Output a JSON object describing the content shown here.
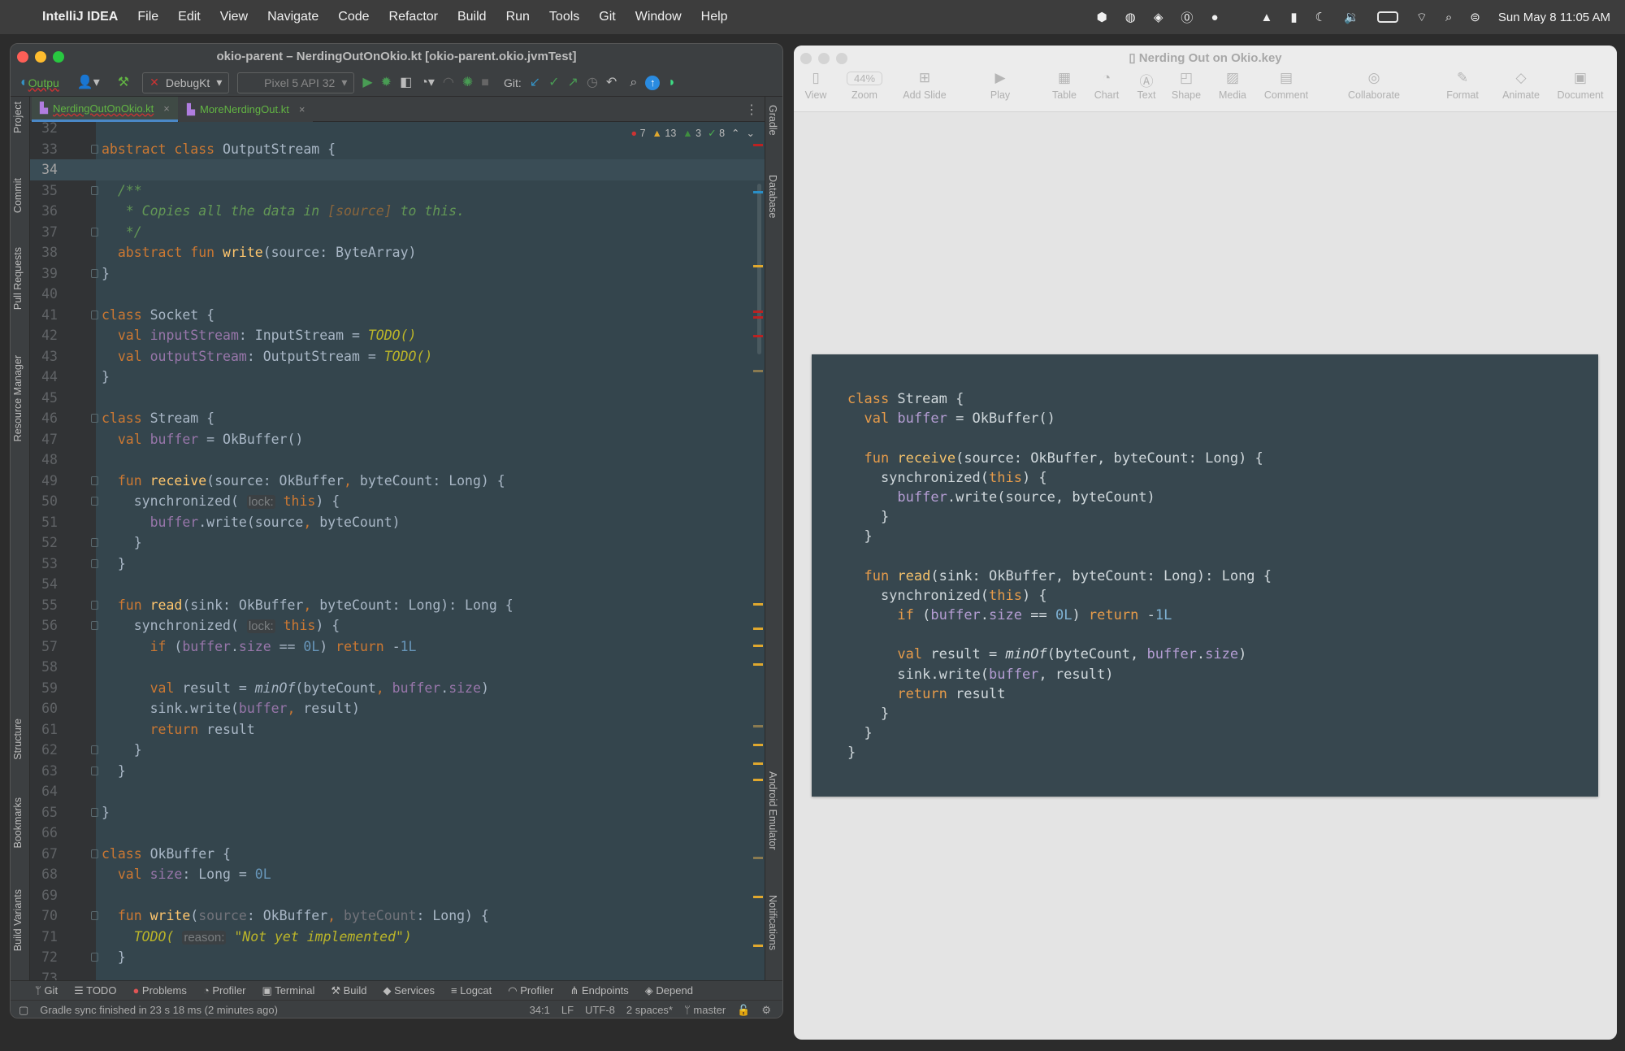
{
  "menubar": {
    "app": "IntelliJ IDEA",
    "items": [
      "File",
      "Edit",
      "View",
      "Navigate",
      "Code",
      "Refactor",
      "Build",
      "Run",
      "Tools",
      "Git",
      "Window",
      "Help"
    ],
    "clock": "Sun May 8  11:05 AM"
  },
  "ide": {
    "title": "okio-parent – NerdingOutOnOkio.kt [okio-parent.okio.jvmTest]",
    "toolbar": {
      "config": "Outpu",
      "run_config": "DebugKt",
      "device": "Pixel 5 API 32",
      "git_label": "Git:"
    },
    "tabs": [
      {
        "label": "NerdingOutOnOkio.kt",
        "active": true
      },
      {
        "label": "MoreNerdingOut.kt",
        "active": false
      }
    ],
    "left_tools": [
      "Project",
      "Commit",
      "Pull Requests",
      "Resource Manager",
      "Structure",
      "Bookmarks",
      "Build Variants"
    ],
    "right_tools": [
      "Gradle",
      "Database",
      "Android Emulator",
      "Notifications"
    ],
    "inspections": {
      "errors": "7",
      "warnings": "13",
      "weak_warnings": "3",
      "typos": "8"
    },
    "current_line": 34,
    "code": [
      [
        32,
        []
      ],
      [
        33,
        [
          [
            "k",
            "abstract class "
          ],
          [
            "p",
            "OutputStream {"
          ]
        ]
      ],
      [
        34,
        []
      ],
      [
        35,
        [
          [
            "c",
            "  /**"
          ]
        ]
      ],
      [
        36,
        [
          [
            "c",
            "   * Copies all the data in "
          ],
          [
            "cr",
            "[source]"
          ],
          [
            "c",
            " to this."
          ]
        ]
      ],
      [
        37,
        [
          [
            "c",
            "   */"
          ]
        ]
      ],
      [
        38,
        [
          [
            "k",
            "  abstract fun "
          ],
          [
            "f",
            "write"
          ],
          [
            "p",
            "(source: ByteArray)"
          ]
        ]
      ],
      [
        39,
        [
          [
            "p",
            "}"
          ]
        ]
      ],
      [
        40,
        []
      ],
      [
        41,
        [
          [
            "k",
            "class "
          ],
          [
            "p",
            "Socket {"
          ]
        ]
      ],
      [
        42,
        [
          [
            "k",
            "  val "
          ],
          [
            "v",
            "inputStream"
          ],
          [
            "p",
            ": InputStream = "
          ],
          [
            "t",
            "TODO()"
          ]
        ]
      ],
      [
        43,
        [
          [
            "k",
            "  val "
          ],
          [
            "v",
            "outputStream"
          ],
          [
            "p",
            ": OutputStream = "
          ],
          [
            "t",
            "TODO()"
          ]
        ]
      ],
      [
        44,
        [
          [
            "p",
            "}"
          ]
        ]
      ],
      [
        45,
        []
      ],
      [
        46,
        [
          [
            "k",
            "class "
          ],
          [
            "p",
            "Stream {"
          ]
        ]
      ],
      [
        47,
        [
          [
            "k",
            "  val "
          ],
          [
            "v",
            "buffer"
          ],
          [
            "p",
            " = OkBuffer()"
          ]
        ]
      ],
      [
        48,
        []
      ],
      [
        49,
        [
          [
            "k",
            "  fun "
          ],
          [
            "f",
            "receive"
          ],
          [
            "p",
            "(source: OkBuffer"
          ],
          [
            "k",
            ","
          ],
          [
            "p",
            " byteCount: Long) {"
          ]
        ]
      ],
      [
        50,
        [
          [
            "p",
            "    synchronized( "
          ],
          [
            "h",
            "lock:"
          ],
          [
            "k",
            " this"
          ],
          [
            "p",
            ") {"
          ]
        ]
      ],
      [
        51,
        [
          [
            "p",
            "      "
          ],
          [
            "v",
            "buffer"
          ],
          [
            "p",
            ".write(source"
          ],
          [
            "k",
            ","
          ],
          [
            "p",
            " byteCount)"
          ]
        ]
      ],
      [
        52,
        [
          [
            "p",
            "    }"
          ]
        ]
      ],
      [
        53,
        [
          [
            "p",
            "  }"
          ]
        ]
      ],
      [
        54,
        []
      ],
      [
        55,
        [
          [
            "k",
            "  fun "
          ],
          [
            "f",
            "read"
          ],
          [
            "p",
            "(sink: OkBuffer"
          ],
          [
            "k",
            ","
          ],
          [
            "p",
            " byteCount: Long): Long {"
          ]
        ]
      ],
      [
        56,
        [
          [
            "p",
            "    synchronized( "
          ],
          [
            "h",
            "lock:"
          ],
          [
            "k",
            " this"
          ],
          [
            "p",
            ") {"
          ]
        ]
      ],
      [
        57,
        [
          [
            "k",
            "      if "
          ],
          [
            "p",
            "("
          ],
          [
            "v",
            "buffer"
          ],
          [
            "p",
            "."
          ],
          [
            "v",
            "size"
          ],
          [
            "p",
            " == "
          ],
          [
            "n",
            "0L"
          ],
          [
            "p",
            ") "
          ],
          [
            "k",
            "return "
          ],
          [
            "p",
            "-"
          ],
          [
            "n",
            "1L"
          ]
        ]
      ],
      [
        58,
        []
      ],
      [
        59,
        [
          [
            "k",
            "      val "
          ],
          [
            "p",
            "result = "
          ],
          [
            "i",
            "minOf"
          ],
          [
            "p",
            "(byteCount"
          ],
          [
            "k",
            ","
          ],
          [
            "p",
            " "
          ],
          [
            "v",
            "buffer"
          ],
          [
            "p",
            "."
          ],
          [
            "v",
            "size"
          ],
          [
            "p",
            ")"
          ]
        ]
      ],
      [
        60,
        [
          [
            "p",
            "      sink.write("
          ],
          [
            "v",
            "buffer"
          ],
          [
            "k",
            ","
          ],
          [
            "p",
            " result)"
          ]
        ]
      ],
      [
        61,
        [
          [
            "k",
            "      return "
          ],
          [
            "p",
            "result"
          ]
        ]
      ],
      [
        62,
        [
          [
            "p",
            "    }"
          ]
        ]
      ],
      [
        63,
        [
          [
            "p",
            "  }"
          ]
        ]
      ],
      [
        64,
        []
      ],
      [
        65,
        [
          [
            "p",
            "}"
          ]
        ]
      ],
      [
        66,
        []
      ],
      [
        67,
        [
          [
            "k",
            "class "
          ],
          [
            "p",
            "OkBuffer {"
          ]
        ]
      ],
      [
        68,
        [
          [
            "k",
            "  val "
          ],
          [
            "v",
            "size"
          ],
          [
            "p",
            ": Long = "
          ],
          [
            "n",
            "0L"
          ]
        ]
      ],
      [
        69,
        []
      ],
      [
        70,
        [
          [
            "k",
            "  fun "
          ],
          [
            "f",
            "write"
          ],
          [
            "p",
            "("
          ],
          [
            "u",
            "source"
          ],
          [
            "p",
            ": OkBuffer"
          ],
          [
            "k",
            ","
          ],
          [
            "p",
            " "
          ],
          [
            "u",
            "byteCount"
          ],
          [
            "p",
            ": Long) {"
          ]
        ]
      ],
      [
        71,
        [
          [
            "t",
            "    TODO( "
          ],
          [
            "h",
            "reason:"
          ],
          [
            "t",
            " \"Not yet implemented\")"
          ]
        ]
      ],
      [
        72,
        [
          [
            "p",
            "  }"
          ]
        ]
      ],
      [
        73,
        []
      ]
    ],
    "bottom_tools": [
      "Git",
      "TODO",
      "Problems",
      "Profiler",
      "Terminal",
      "Build",
      "Services",
      "Logcat",
      "Profiler",
      "Endpoints",
      "Depend"
    ],
    "status": {
      "message": "Gradle sync finished in 23 s 18 ms (2 minutes ago)",
      "position": "34:1",
      "line_sep": "LF",
      "encoding": "UTF-8",
      "indent": "2 spaces*",
      "branch": "master"
    }
  },
  "keynote": {
    "title": "Nerding Out on Okio.key",
    "zoom": "44%",
    "toolbar": [
      "View",
      "Zoom",
      "Add Slide",
      "Play",
      "Table",
      "Chart",
      "Text",
      "Shape",
      "Media",
      "Comment",
      "Collaborate",
      "Format",
      "Animate",
      "Document"
    ],
    "slide_code": [
      [
        [
          "k",
          "class "
        ],
        [
          "p",
          "Stream {"
        ]
      ],
      [
        [
          "k",
          "  val "
        ],
        [
          "v",
          "buffer"
        ],
        [
          "p",
          " = OkBuffer()"
        ]
      ],
      [],
      [
        [
          "k",
          "  fun "
        ],
        [
          "f",
          "receive"
        ],
        [
          "p",
          "(source: OkBuffer, byteCount: Long) {"
        ]
      ],
      [
        [
          "p",
          "    synchronized("
        ],
        [
          "k",
          "this"
        ],
        [
          "p",
          ") {"
        ]
      ],
      [
        [
          "p",
          "      "
        ],
        [
          "v",
          "buffer"
        ],
        [
          "p",
          ".write(source, byteCount)"
        ]
      ],
      [
        [
          "p",
          "    }"
        ]
      ],
      [
        [
          "p",
          "  }"
        ]
      ],
      [],
      [
        [
          "k",
          "  fun "
        ],
        [
          "f",
          "read"
        ],
        [
          "p",
          "(sink: OkBuffer, byteCount: Long): Long {"
        ]
      ],
      [
        [
          "p",
          "    synchronized("
        ],
        [
          "k",
          "this"
        ],
        [
          "p",
          ") {"
        ]
      ],
      [
        [
          "k",
          "      if "
        ],
        [
          "p",
          "("
        ],
        [
          "v",
          "buffer"
        ],
        [
          "p",
          "."
        ],
        [
          "v",
          "size"
        ],
        [
          "p",
          " == "
        ],
        [
          "n",
          "0L"
        ],
        [
          "p",
          ") "
        ],
        [
          "k",
          "return "
        ],
        [
          "p",
          "-"
        ],
        [
          "n",
          "1L"
        ]
      ],
      [],
      [
        [
          "k",
          "      val "
        ],
        [
          "p",
          "result = "
        ],
        [
          "i",
          "minOf"
        ],
        [
          "p",
          "(byteCount, "
        ],
        [
          "v",
          "buffer"
        ],
        [
          "p",
          "."
        ],
        [
          "v",
          "size"
        ],
        [
          "p",
          ")"
        ]
      ],
      [
        [
          "p",
          "      sink.write("
        ],
        [
          "v",
          "buffer"
        ],
        [
          "p",
          ", result)"
        ]
      ],
      [
        [
          "k",
          "      return "
        ],
        [
          "p",
          "result"
        ]
      ],
      [
        [
          "p",
          "    }"
        ]
      ],
      [
        [
          "p",
          "  }"
        ]
      ],
      [
        [
          "p",
          "}"
        ]
      ]
    ]
  },
  "colors": {
    "editor_bg": "#34454d",
    "keyword": "#cc7832",
    "function": "#ffc66d",
    "property": "#9876aa",
    "number": "#6897bb",
    "doc_comment": "#629755",
    "todo": "#bbb529",
    "slide_bg": "#37474f"
  }
}
